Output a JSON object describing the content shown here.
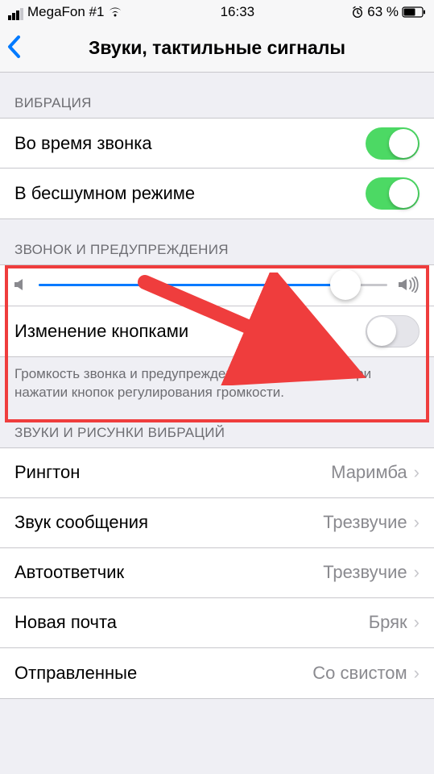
{
  "status": {
    "carrier": "MegaFon #1",
    "time": "16:33",
    "battery": "63 %"
  },
  "nav": {
    "title": "Звуки, тактильные сигналы"
  },
  "sections": {
    "vibration": {
      "header": "ВИБРАЦИЯ",
      "ring": "Во время звонка",
      "silent": "В бесшумном режиме"
    },
    "ringer": {
      "header": "ЗВОНОК И ПРЕДУПРЕЖДЕНИЯ",
      "change_with_buttons": "Изменение кнопками",
      "footer": "Громкость звонка и предупреждений не изменяется при нажатии кнопок регулирования громкости."
    },
    "sounds": {
      "header": "ЗВУКИ И РИСУНКИ ВИБРАЦИЙ",
      "ringtone": {
        "label": "Рингтон",
        "value": "Маримба"
      },
      "text": {
        "label": "Звук сообщения",
        "value": "Трезвучие"
      },
      "voicemail": {
        "label": "Автоответчик",
        "value": "Трезвучие"
      },
      "mail": {
        "label": "Новая почта",
        "value": "Бряк"
      },
      "sent": {
        "label": "Отправленные",
        "value": "Со свистом"
      }
    }
  },
  "slider": {
    "value_percent": 88
  }
}
